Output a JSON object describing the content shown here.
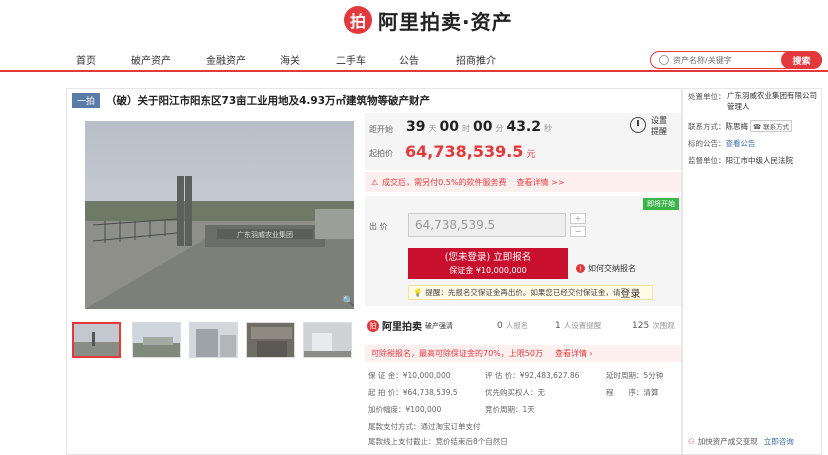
{
  "brand": {
    "mark": "拍",
    "title": "阿里拍卖·资产"
  },
  "nav": {
    "items": [
      "首页",
      "破产资产",
      "金融资产",
      "海关",
      "二手车",
      "公告",
      "招商推介"
    ],
    "search_placeholder": "资产名称/关键字",
    "search_button": "搜索"
  },
  "item": {
    "badge": "一拍",
    "title": "（破）关于阳江市阳东区73亩工业用地及4.93万㎡建筑物等破产财产",
    "sign_text": "广东羽威农业集团"
  },
  "price": {
    "countdown_label": "距开始",
    "days": "39",
    "days_unit": "天",
    "hours": "00",
    "hours_unit": "时",
    "minutes": "00",
    "minutes_unit": "分",
    "seconds": "43.2",
    "seconds_unit": "秒",
    "start_label": "起拍价",
    "start_price": "64,738,539.5",
    "start_unit": "元",
    "remind_l1": "设置",
    "remind_l2": "提醒"
  },
  "service_notice": {
    "text": "成交后，需另付0.5%的软件服务费",
    "link": "查看详情 >>"
  },
  "bid": {
    "live_tag": "即将开始",
    "label": "出 价",
    "value": "64,738,539.5",
    "plus": "+",
    "minus": "−",
    "signup_l1": "(您未登录) 立即报名",
    "signup_l2": "保证金 ¥10,000,000",
    "howto": "如何交纳报名",
    "tip": "提醒：先报名交保证金再出价。如果您已经交付保证金，请",
    "tip_login": "登录"
  },
  "stats": {
    "logo": "阿里拍卖",
    "logo_sub": "破产强清",
    "signups": "0",
    "signups_label": "人报名",
    "reminders": "1",
    "reminders_label": "人设置提醒",
    "views": "125",
    "views_label": "次围观"
  },
  "deposit_notice": {
    "text": "可除税报名，最高可除保证金的70%，上限50万",
    "link": "查看详情 ›"
  },
  "details": {
    "deposit": "保 证 金：¥10,000,000",
    "start": "起 拍 价：¥64,738,539.5",
    "increment": "加价幅度：¥100,000",
    "appraisal": "评 估 价：¥92,483,627.86",
    "priority": "优先购买权人：无",
    "cycle": "竞价周期：1天",
    "delay": "延时周期：5分钟",
    "order": "程　　序：清算",
    "pay_method": "尾款支付方式：通过淘宝订单支付",
    "pay_deadline": "尾款线上支付截止：竞价结束后8个自然日"
  },
  "sidebar": {
    "org_label": "处置单位：",
    "org_value": "广东羽威农业集团有限公司管理人",
    "contact_label": "联系方式：",
    "contact_name": "陈思梅",
    "contact_tag": "联系方式",
    "notice_label": "标的公告：",
    "notice_link": "查看公告",
    "supervisor_label": "监督单位：",
    "supervisor_value": "阳江市中级人民法院",
    "bottom_text": "加快资产成交变现",
    "bottom_link": "立即咨询"
  }
}
